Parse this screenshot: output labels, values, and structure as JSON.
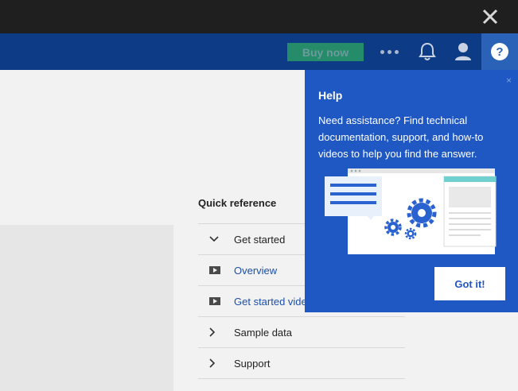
{
  "window": {
    "close_icon": "close-icon"
  },
  "header": {
    "buy_now_label": "Buy now",
    "icons": [
      "more-icon",
      "notification-bell-icon",
      "user-icon",
      "help-icon"
    ],
    "help_glyph": "?"
  },
  "quick_reference": {
    "title": "Quick reference",
    "items": [
      {
        "label": "Get started",
        "icon": "chevron-down-icon"
      },
      {
        "label": "Overview",
        "icon": "video-play-icon"
      },
      {
        "label": "Get started video",
        "icon": "video-play-icon"
      },
      {
        "label": "Sample data",
        "icon": "chevron-right-icon"
      },
      {
        "label": "Support",
        "icon": "chevron-right-icon"
      }
    ]
  },
  "help_popover": {
    "title": "Help",
    "body": "Need assistance? Find technical documentation, support, and how-to videos to help you find the answer.",
    "close_glyph": "×",
    "button_label": "Got it!"
  },
  "colors": {
    "header_bg": "#0e3b86",
    "popover_bg": "#1f57c3",
    "buy_button_bg": "#258b68",
    "topbar_bg": "#1f1f1f"
  }
}
